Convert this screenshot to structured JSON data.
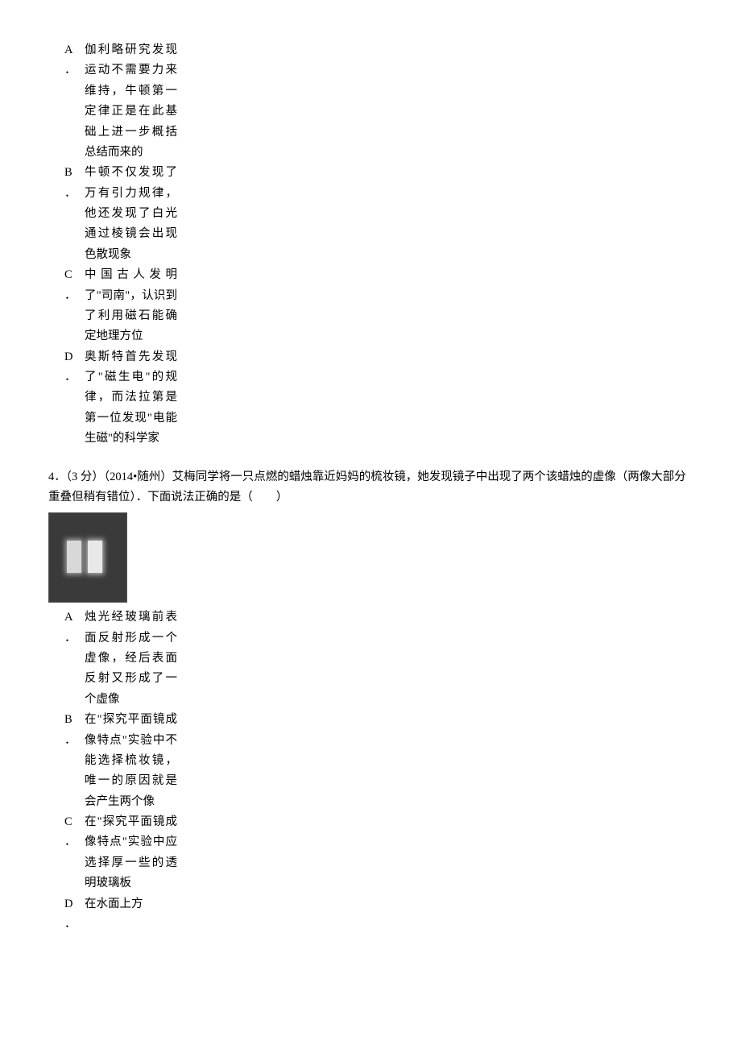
{
  "q3": {
    "optA_letter": "A",
    "optA_period": "．",
    "optA_text": "伽利略研究发现运动不需要力来维持，牛顿第一定律正是在此基础上进一步概括总结而来的",
    "optB_letter": "B",
    "optB_period": "．",
    "optB_text": "牛顿不仅发现了万有引力规律，他还发现了白光通过棱镜会出现色散现象",
    "optC_letter": "C",
    "optC_period": "．",
    "optC_text": "中国古人发明了\"司南\"，认识到了利用磁石能确定地理方位",
    "optD_letter": "D",
    "optD_period": "．",
    "optD_text": "奥斯特首先发现了\"磁生电\"的规律，而法拉第是第一位发现\"电能生磁\"的科学家"
  },
  "q4": {
    "stem": "4．（3 分）（2014•随州）艾梅同学将一只点燃的蜡烛靠近妈妈的梳妆镜，她发现镜子中出现了两个该蜡烛的虚像（两像大部分重叠但稍有错位）．下面说法正确的是（　　）",
    "optA_letter": "A",
    "optA_period": "．",
    "optA_text": "烛光经玻璃前表面反射形成一个虚像，经后表面反射又形成了一个虚像",
    "optB_letter": "B",
    "optB_period": "．",
    "optB_text": "在\"探究平面镜成像特点\"实验中不能选择梳妆镜，唯一的原因就是会产生两个像",
    "optC_letter": "C",
    "optC_period": "．",
    "optC_text": "在\"探究平面镜成像特点\"实验中应选择厚一些的透明玻璃板",
    "optD_letter": "D",
    "optD_period": "．",
    "optD_text": "在水面上方"
  }
}
